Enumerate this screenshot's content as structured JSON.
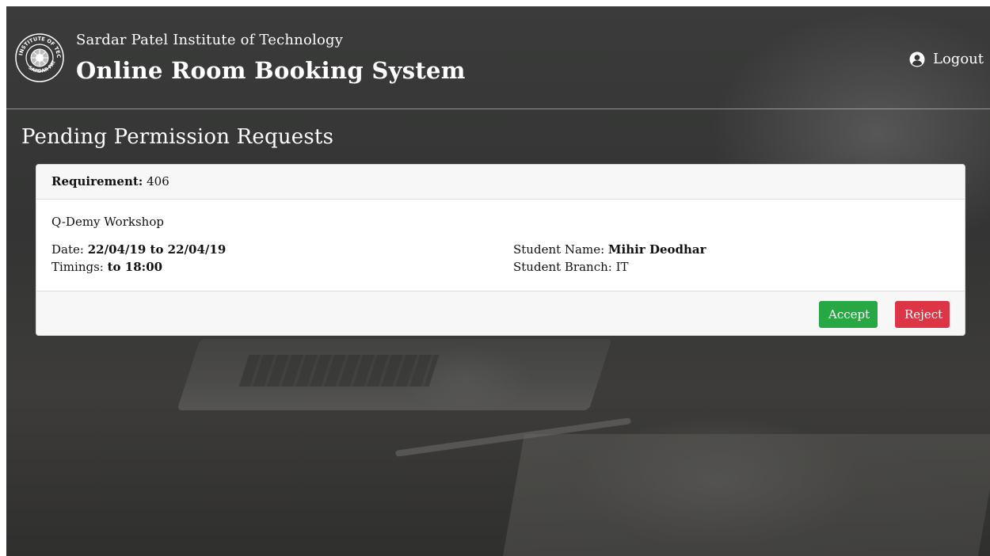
{
  "header": {
    "institute": "Sardar Patel Institute of Technology",
    "app_title": "Online Room Booking System",
    "logout_label": "Logout",
    "logo_text_top": "INSTITUTE OF TECHNOLOGY",
    "logo_text_bottom": "SARDAR PATEL"
  },
  "page": {
    "title": "Pending Permission Requests"
  },
  "request": {
    "requirement_label": "Requirement:",
    "requirement_value": "406",
    "event_name": "Q-Demy Workshop",
    "date_label": "Date:",
    "date_value": "22/04/19 to 22/04/19",
    "timings_label": "Timings:",
    "timings_value": "to 18:00",
    "student_name_label": "Student Name:",
    "student_name_value": "Mihir Deodhar",
    "student_branch_label": "Student Branch:",
    "student_branch_value": "IT"
  },
  "actions": {
    "accept_label": "Accept",
    "reject_label": "Reject"
  },
  "colors": {
    "accept": "#28a745",
    "reject": "#dc3545"
  },
  "icons": {
    "logout": "user-circle-icon",
    "logo": "institute-seal-icon"
  }
}
